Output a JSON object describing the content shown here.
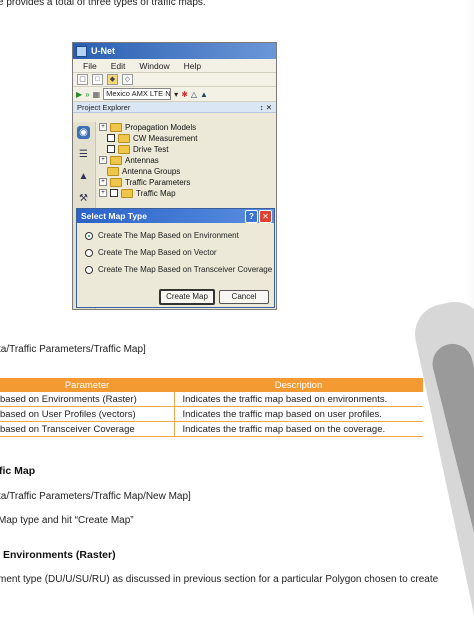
{
  "doc": {
    "top_line": "e provides a total of three types of traffic maps.",
    "path_line": "ta/Traffic Parameters/Traffic Map]",
    "section_title": "fic Map",
    "path_line2": "ta/Traffic Parameters/Traffic Map/New Map]",
    "instruction": "Map type and hit “Create Map”",
    "subsection": "Environments (Raster)",
    "bottom_line": "ment type (DU/U/SU/RU) as discussed in previous section for a particular Polygon chosen to create"
  },
  "table": {
    "headers": [
      "Parameter",
      "Description"
    ],
    "rows": [
      [
        "based on Environments (Raster)",
        "Indicates the traffic map based on environments."
      ],
      [
        "based on User Profiles (vectors)",
        "Indicates the traffic map based on user profiles."
      ],
      [
        "based on Transceiver Coverage",
        "Indicates the traffic map based on the coverage."
      ]
    ]
  },
  "screenshot": {
    "title": "U-Net",
    "menu": [
      "File",
      "Edit",
      "Window",
      "Help"
    ],
    "network_combo": "Mexico AMX LTE N",
    "panel_title": "Project Explorer",
    "panel_controls": "↕ ✕",
    "tree": [
      "Propagation Models",
      "CW Measurement",
      "Drive Test",
      "Antennas",
      "Antenna Groups",
      "Traffic Parameters",
      "Traffic Map"
    ],
    "dialog": {
      "title": "Select Map Type",
      "options": [
        "Create The Map Based on Environment",
        "Create The Map Based on Vector",
        "Create The Map Based on Transceiver Coverage"
      ],
      "selected_index": 0,
      "create_label": "Create Map",
      "cancel_label": "Cancel"
    }
  },
  "colors": {
    "table_header": "#f39a33",
    "dialog_title": "#2a62c8",
    "close_button": "#d9432f"
  },
  "icons": [
    "folder-icon",
    "help-icon",
    "close-icon",
    "app-icon"
  ]
}
